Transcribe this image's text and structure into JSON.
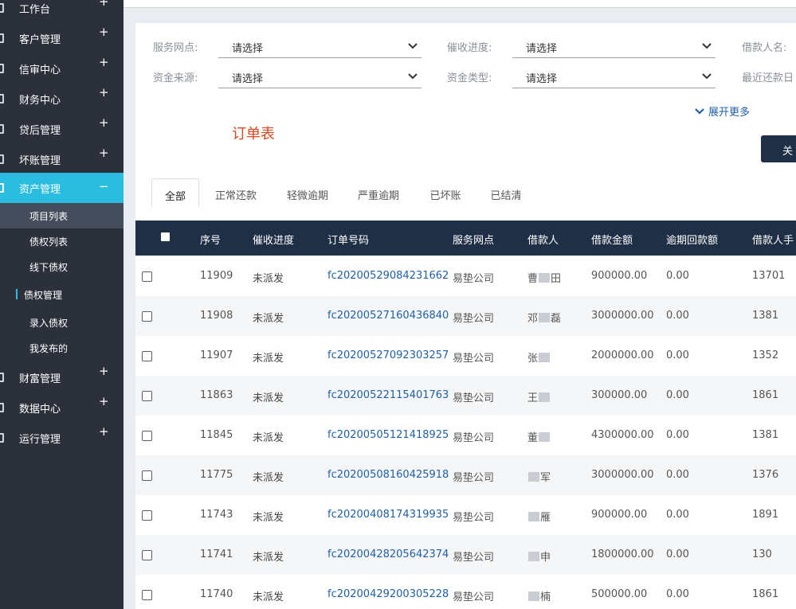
{
  "sidebar": {
    "items": [
      {
        "label": "工作台",
        "icon": "dashboard-icon",
        "expander": "+"
      },
      {
        "label": "客户管理",
        "icon": "customer-icon",
        "expander": "+"
      },
      {
        "label": "信审中心",
        "icon": "audit-icon",
        "expander": "+"
      },
      {
        "label": "财务中心",
        "icon": "finance-icon",
        "expander": "+"
      },
      {
        "label": "贷后管理",
        "icon": "post-loan-icon",
        "expander": "+"
      },
      {
        "label": "坏账管理",
        "icon": "bad-debt-icon",
        "expander": "+"
      },
      {
        "label": "资产管理",
        "icon": "asset-icon",
        "expander": "−"
      },
      {
        "label": "财富管理",
        "icon": "wealth-icon",
        "expander": "+"
      },
      {
        "label": "数据中心",
        "icon": "data-icon",
        "expander": "+"
      },
      {
        "label": "运行管理",
        "icon": "operation-icon",
        "expander": "+"
      }
    ],
    "asset_sub": [
      {
        "label": "项目列表"
      },
      {
        "label": "债权列表"
      },
      {
        "label": "线下债权"
      }
    ],
    "group": {
      "label": "债权管理"
    },
    "group_sub": [
      {
        "label": "录入债权"
      },
      {
        "label": "我发布的"
      }
    ]
  },
  "filters": {
    "service_point": {
      "label": "服务网点:",
      "value": "请选择"
    },
    "collection_progress": {
      "label": "催收进度:",
      "value": "请选择"
    },
    "borrower_name": {
      "label": "借款人名:"
    },
    "fund_source": {
      "label": "资金来源:",
      "value": "请选择"
    },
    "fund_type": {
      "label": "资金类型:",
      "value": "请选择"
    },
    "recent_repay": {
      "label": "最近还款日"
    },
    "expand_label": "展开更多"
  },
  "order_title": "订单表",
  "close_button": "关",
  "tabs": [
    {
      "label": "全部"
    },
    {
      "label": "正常还款"
    },
    {
      "label": "轻微逾期"
    },
    {
      "label": "严重逾期"
    },
    {
      "label": "已坏账"
    },
    {
      "label": "已结清"
    }
  ],
  "table": {
    "headers": {
      "seq": "序号",
      "progress": "催收进度",
      "order_no": "订单号码",
      "service_point": "服务网点",
      "borrower": "借款人",
      "amount": "借款金额",
      "overdue_paid": "逾期回款额",
      "phone": "借款人手"
    },
    "rows": [
      {
        "seq": "11909",
        "progress": "未派发",
        "order_no": "fc20200529084231662",
        "service_point": "易垫公司",
        "borrower_a": "曹",
        "borrower_b": "田",
        "amount": "900000.00",
        "overdue_paid": "0.00",
        "phone": "13701"
      },
      {
        "seq": "11908",
        "progress": "未派发",
        "order_no": "fc20200527160436840",
        "service_point": "易垫公司",
        "borrower_a": "邓",
        "borrower_b": "磊",
        "amount": "3000000.00",
        "overdue_paid": "0.00",
        "phone": "1381"
      },
      {
        "seq": "11907",
        "progress": "未派发",
        "order_no": "fc20200527092303257",
        "service_point": "易垫公司",
        "borrower_a": "张",
        "borrower_b": "",
        "amount": "2000000.00",
        "overdue_paid": "0.00",
        "phone": "1352"
      },
      {
        "seq": "11863",
        "progress": "未派发",
        "order_no": "fc20200522115401763",
        "service_point": "易垫公司",
        "borrower_a": "王",
        "borrower_b": "",
        "amount": "300000.00",
        "overdue_paid": "0.00",
        "phone": "1861"
      },
      {
        "seq": "11845",
        "progress": "未派发",
        "order_no": "fc20200505121418925",
        "service_point": "易垫公司",
        "borrower_a": "董",
        "borrower_b": "",
        "amount": "4300000.00",
        "overdue_paid": "0.00",
        "phone": "1381"
      },
      {
        "seq": "11775",
        "progress": "未派发",
        "order_no": "fc20200508160425918",
        "service_point": "易垫公司",
        "borrower_a": "",
        "borrower_b": "军",
        "amount": "3000000.00",
        "overdue_paid": "0.00",
        "phone": "1376"
      },
      {
        "seq": "11743",
        "progress": "未派发",
        "order_no": "fc20200408174319935",
        "service_point": "易垫公司",
        "borrower_a": "",
        "borrower_b": "雁",
        "amount": "900000.00",
        "overdue_paid": "0.00",
        "phone": "1891"
      },
      {
        "seq": "11741",
        "progress": "未派发",
        "order_no": "fc20200428205642374",
        "service_point": "易垫公司",
        "borrower_a": "",
        "borrower_b": "申",
        "amount": "1800000.00",
        "overdue_paid": "0.00",
        "phone": "130"
      },
      {
        "seq": "11740",
        "progress": "未派发",
        "order_no": "fc20200429200305228",
        "service_point": "易垫公司",
        "borrower_a": "",
        "borrower_b": "楠",
        "amount": "500000.00",
        "overdue_paid": "0.00",
        "phone": "1861"
      }
    ]
  },
  "colors": {
    "sidebar_bg": "#2b303b",
    "sidebar_active": "#2bbde0",
    "header_bg": "#1f2f46",
    "link": "#1f5fa8",
    "title": "#e0451c"
  }
}
